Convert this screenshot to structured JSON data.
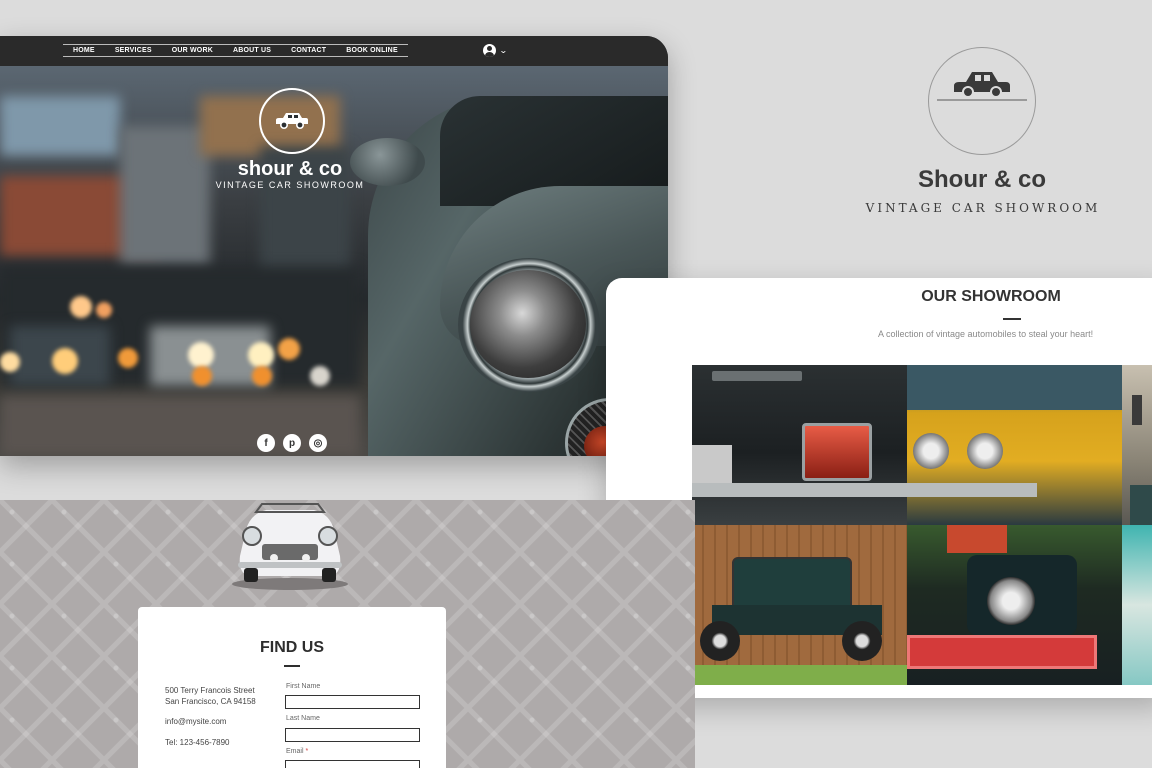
{
  "nav": {
    "items": [
      "HOME",
      "SERVICES",
      "OUR WORK",
      "ABOUT US",
      "CONTACT",
      "BOOK ONLINE"
    ],
    "user_icon": "user-circle-icon",
    "chevron": "⌄"
  },
  "hero": {
    "brand": "shour & co",
    "tagline": "VINTAGE CAR SHOWROOM",
    "social": [
      {
        "icon": "facebook-icon",
        "glyph": "f"
      },
      {
        "icon": "pinterest-icon",
        "glyph": "p"
      },
      {
        "icon": "instagram-icon",
        "glyph": "◎"
      }
    ]
  },
  "logo_panel": {
    "title": "Shour & co",
    "subtitle": "VINTAGE CAR SHOWROOM"
  },
  "showroom": {
    "title": "OUR SHOWROOM",
    "subtitle": "A collection of vintage automobiles to steal your heart!",
    "tiles": [
      "peugeot-rear-photo",
      "yellow-car-photo",
      "street-photo",
      "model-a-photo",
      "truck-photo",
      "teal-car-photo"
    ]
  },
  "find_us": {
    "title": "FIND US",
    "address_line1": "500 Terry Francois Street",
    "address_line2": "San Francisco, CA 94158",
    "email": "info@mysite.com",
    "phone": "Tel: 123-456-7890",
    "form": {
      "first_name_label": "First Name",
      "last_name_label": "Last Name",
      "email_label": "Email",
      "required_mark": "*"
    }
  },
  "colors": {
    "page_bg": "#dcdcdc",
    "nav_bg": "#2a2a2a",
    "text_dark": "#3a3a3a",
    "find_bg": "#aeaaaa",
    "required": "#d0393a"
  }
}
